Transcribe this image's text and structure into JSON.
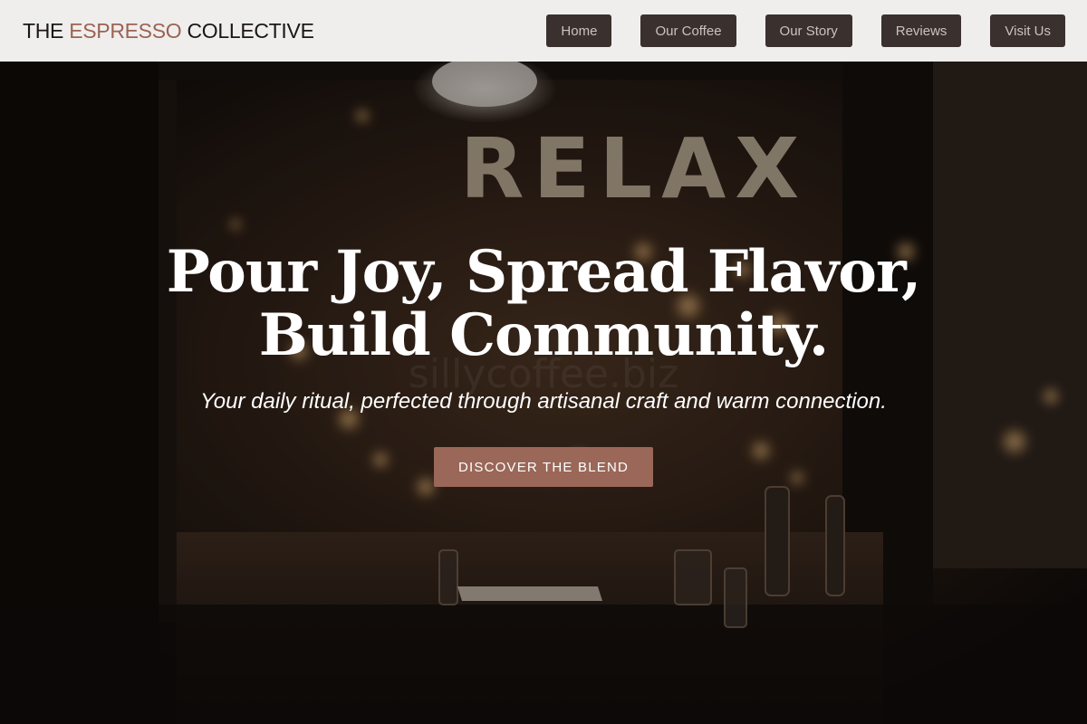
{
  "header": {
    "logo_part1": "THE",
    "logo_accent": "ESPRESSO",
    "logo_part2": "COLLECTIVE",
    "nav": [
      "Home",
      "Our Coffee",
      "Our Story",
      "Reviews",
      "Visit Us"
    ]
  },
  "hero": {
    "window_sign": "RELAX",
    "watermark": "sillycoffee.biz",
    "headline_line1": "Pour Joy, Spread Flavor,",
    "headline_line2": "Build Community.",
    "tagline": "Your daily ritual, perfected through artisanal craft and warm connection.",
    "cta_label": "DISCOVER THE BLEND"
  },
  "colors": {
    "accent": "#9c6352",
    "nav_button_bg": "#3a302d",
    "header_bg": "#efeeed",
    "cta_bg": "#9a6758"
  }
}
